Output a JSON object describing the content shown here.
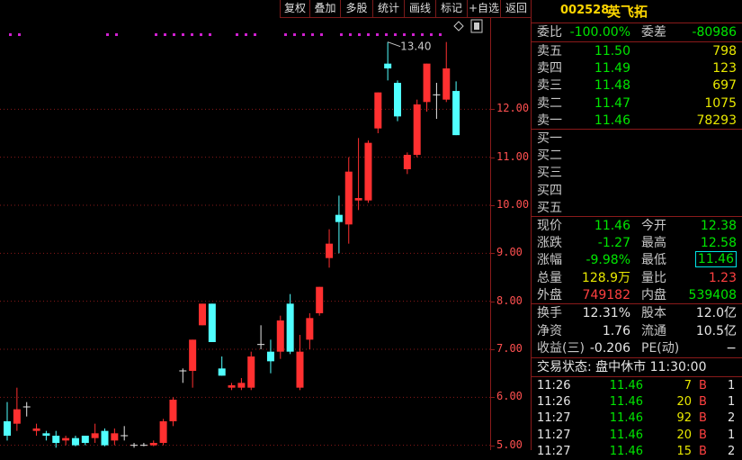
{
  "toolbar": {
    "buttons": [
      "复权",
      "叠加",
      "多股",
      "统计",
      "画线",
      "标记",
      "+自选",
      "返回"
    ]
  },
  "chart": {
    "high_marker": "13.40",
    "corner_icon": "diamond-icon",
    "axis_ticks": [
      "12.00",
      "11.00",
      "10.00",
      "9.00",
      "8.00",
      "7.00",
      "6.00",
      "5.00"
    ]
  },
  "chart_data": {
    "type": "candlestick",
    "ylim": [
      4.9,
      13.9
    ],
    "colors": {
      "up": "#ff3030",
      "down": "#50ffff",
      "flat": "#e6e6e6"
    },
    "candles": [
      {
        "o": 5.5,
        "h": 5.9,
        "l": 5.1,
        "c": 5.2
      },
      {
        "o": 5.45,
        "h": 6.2,
        "l": 5.3,
        "c": 5.75
      },
      {
        "o": 5.8,
        "h": 5.9,
        "l": 5.6,
        "c": 5.8
      },
      {
        "o": 5.3,
        "h": 5.45,
        "l": 5.2,
        "c": 5.35
      },
      {
        "o": 5.25,
        "h": 5.3,
        "l": 5.1,
        "c": 5.2
      },
      {
        "o": 5.2,
        "h": 5.3,
        "l": 4.95,
        "c": 5.05
      },
      {
        "o": 5.1,
        "h": 5.2,
        "l": 5.0,
        "c": 5.15
      },
      {
        "o": 5.15,
        "h": 5.2,
        "l": 4.98,
        "c": 5.0
      },
      {
        "o": 5.2,
        "h": 5.2,
        "l": 5.0,
        "c": 5.05
      },
      {
        "o": 5.15,
        "h": 5.45,
        "l": 5.05,
        "c": 5.25
      },
      {
        "o": 5.3,
        "h": 5.35,
        "l": 4.98,
        "c": 5.0
      },
      {
        "o": 5.1,
        "h": 5.35,
        "l": 5.0,
        "c": 5.25
      },
      {
        "o": 5.2,
        "h": 5.4,
        "l": 5.1,
        "c": 5.2
      },
      {
        "o": 5.0,
        "h": 5.05,
        "l": 4.95,
        "c": 5.0
      },
      {
        "o": 5.0,
        "h": 5.05,
        "l": 4.98,
        "c": 5.0
      },
      {
        "o": 5.0,
        "h": 5.1,
        "l": 4.98,
        "c": 5.05
      },
      {
        "o": 5.05,
        "h": 5.55,
        "l": 5.0,
        "c": 5.5
      },
      {
        "o": 5.5,
        "h": 6.0,
        "l": 5.4,
        "c": 5.95
      },
      {
        "o": 6.55,
        "h": 6.6,
        "l": 6.3,
        "c": 6.55
      },
      {
        "o": 6.55,
        "h": 7.2,
        "l": 6.2,
        "c": 7.2
      },
      {
        "o": 7.5,
        "h": 7.95,
        "l": 7.5,
        "c": 7.95
      },
      {
        "o": 7.95,
        "h": 7.95,
        "l": 7.15,
        "c": 7.15
      },
      {
        "o": 6.6,
        "h": 6.85,
        "l": 6.45,
        "c": 6.45
      },
      {
        "o": 6.2,
        "h": 6.3,
        "l": 6.15,
        "c": 6.25
      },
      {
        "o": 6.2,
        "h": 6.4,
        "l": 6.15,
        "c": 6.3
      },
      {
        "o": 6.2,
        "h": 6.95,
        "l": 6.15,
        "c": 6.85
      },
      {
        "o": 7.1,
        "h": 7.5,
        "l": 7.0,
        "c": 7.1
      },
      {
        "o": 6.95,
        "h": 7.2,
        "l": 6.5,
        "c": 6.75
      },
      {
        "o": 6.95,
        "h": 7.7,
        "l": 6.8,
        "c": 7.6
      },
      {
        "o": 7.95,
        "h": 8.15,
        "l": 6.9,
        "c": 6.95
      },
      {
        "o": 6.2,
        "h": 7.3,
        "l": 6.15,
        "c": 6.95
      },
      {
        "o": 7.2,
        "h": 7.75,
        "l": 7.0,
        "c": 7.65
      },
      {
        "o": 7.75,
        "h": 8.3,
        "l": 7.7,
        "c": 8.3
      },
      {
        "o": 8.9,
        "h": 9.5,
        "l": 8.7,
        "c": 9.2
      },
      {
        "o": 9.8,
        "h": 10.2,
        "l": 9.0,
        "c": 9.65
      },
      {
        "o": 9.6,
        "h": 11.0,
        "l": 9.2,
        "c": 10.7
      },
      {
        "o": 10.1,
        "h": 11.4,
        "l": 9.9,
        "c": 10.15
      },
      {
        "o": 10.1,
        "h": 11.35,
        "l": 10.05,
        "c": 11.3
      },
      {
        "o": 11.6,
        "h": 12.35,
        "l": 11.5,
        "c": 12.35
      },
      {
        "o": 12.95,
        "h": 13.4,
        "l": 12.6,
        "c": 12.85
      },
      {
        "o": 12.55,
        "h": 12.6,
        "l": 11.75,
        "c": 11.85
      },
      {
        "o": 10.75,
        "h": 11.1,
        "l": 10.65,
        "c": 11.05
      },
      {
        "o": 11.05,
        "h": 12.2,
        "l": 11.0,
        "c": 12.1
      },
      {
        "o": 12.15,
        "h": 12.95,
        "l": 11.95,
        "c": 12.95
      },
      {
        "o": 12.3,
        "h": 12.55,
        "l": 11.8,
        "c": 12.3
      },
      {
        "o": 12.2,
        "h": 13.4,
        "l": 12.15,
        "c": 12.85
      },
      {
        "o": 12.38,
        "h": 12.58,
        "l": 11.46,
        "c": 11.46
      }
    ]
  },
  "panel": {
    "code": "002528",
    "name": "英飞拓",
    "weibi_label": "委比",
    "weibi": "-100.00%",
    "weicha_label": "委差",
    "weicha": "-80986",
    "sells": [
      {
        "label": "卖五",
        "price": "11.50",
        "vol": "798"
      },
      {
        "label": "卖四",
        "price": "11.49",
        "vol": "123"
      },
      {
        "label": "卖三",
        "price": "11.48",
        "vol": "697"
      },
      {
        "label": "卖二",
        "price": "11.47",
        "vol": "1075"
      },
      {
        "label": "卖一",
        "price": "11.46",
        "vol": "78293"
      }
    ],
    "buys": [
      {
        "label": "买一"
      },
      {
        "label": "买二"
      },
      {
        "label": "买三"
      },
      {
        "label": "买四"
      },
      {
        "label": "买五"
      }
    ],
    "stats": [
      {
        "l1": "现价",
        "v1": "11.46",
        "c1": "green",
        "l2": "今开",
        "v2": "12.38",
        "c2": "green"
      },
      {
        "l1": "涨跌",
        "v1": "-1.27",
        "c1": "green",
        "l2": "最高",
        "v2": "12.58",
        "c2": "green"
      },
      {
        "l1": "涨幅",
        "v1": "-9.98%",
        "c1": "green",
        "l2": "最低",
        "v2": "11.46",
        "c2": "green",
        "box2": true
      },
      {
        "l1": "总量",
        "v1": "128.9万",
        "c1": "yellow",
        "l2": "量比",
        "v2": "1.23",
        "c2": "red"
      },
      {
        "l1": "外盘",
        "v1": "749182",
        "c1": "red",
        "l2": "内盘",
        "v2": "539408",
        "c2": "green"
      }
    ],
    "stats2": [
      {
        "l1": "换手",
        "v1": "12.31%",
        "l2": "股本",
        "v2": "12.0亿"
      },
      {
        "l1": "净资",
        "v1": "1.76",
        "l2": "流通",
        "v2": "10.5亿"
      },
      {
        "l1": "收益(三)",
        "v1": "-0.206",
        "l2": "PE(动)",
        "v2": "−"
      }
    ],
    "trade_status": "交易状态: 盘中休市 11:30:00",
    "trades": [
      {
        "time": "11:26",
        "price": "11.46",
        "vol": "7",
        "bs": "B",
        "n": "1"
      },
      {
        "time": "11:26",
        "price": "11.46",
        "vol": "20",
        "bs": "B",
        "n": "1"
      },
      {
        "time": "11:27",
        "price": "11.46",
        "vol": "92",
        "bs": "B",
        "n": "2"
      },
      {
        "time": "11:27",
        "price": "11.46",
        "vol": "20",
        "bs": "B",
        "n": "1"
      },
      {
        "time": "11:27",
        "price": "11.46",
        "vol": "15",
        "bs": "B",
        "n": "2"
      }
    ]
  }
}
